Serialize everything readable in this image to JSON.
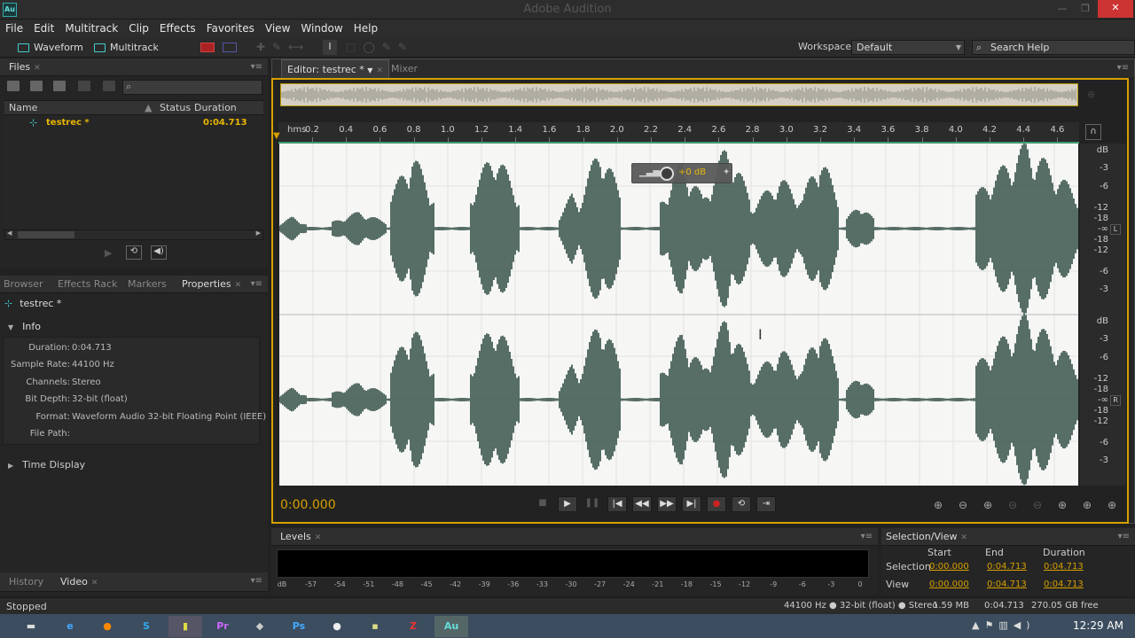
{
  "app": {
    "title": "Adobe Audition",
    "logo": "Au"
  },
  "menu": [
    "File",
    "Edit",
    "Multitrack",
    "Clip",
    "Effects",
    "Favorites",
    "View",
    "Window",
    "Help"
  ],
  "toolbar": {
    "waveform": "Waveform",
    "multitrack": "Multitrack",
    "workspace_label": "Workspace:",
    "workspace_value": "Default",
    "search_placeholder": "Search Help"
  },
  "files": {
    "tab": "Files",
    "columns": {
      "name": "Name",
      "status": "Status",
      "duration": "Duration"
    },
    "items": [
      {
        "name": "testrec *",
        "duration": "0:04.713"
      }
    ]
  },
  "props": {
    "tabs": [
      "Browser",
      "Effects Rack",
      "Markers",
      "Properties"
    ],
    "file": "testrec *",
    "info_header": "Info",
    "rows": [
      {
        "k": "Duration:",
        "v": "0:04.713"
      },
      {
        "k": "Sample Rate:",
        "v": "44100 Hz"
      },
      {
        "k": "Channels:",
        "v": "Stereo"
      },
      {
        "k": "Bit Depth:",
        "v": "32-bit (float)"
      },
      {
        "k": "Format:",
        "v": "Waveform Audio 32-bit Floating Point (IEEE)"
      },
      {
        "k": "File Path:",
        "v": ""
      }
    ],
    "time_display": "Time Display"
  },
  "history": {
    "tabs": [
      "History",
      "Video"
    ]
  },
  "editor": {
    "tab": "Editor: testrec *",
    "mixer": "Mixer",
    "ruler_unit": "hms",
    "ticks": [
      "0.2",
      "0.4",
      "0.6",
      "0.8",
      "1.0",
      "1.2",
      "1.4",
      "1.6",
      "1.8",
      "2.0",
      "2.2",
      "2.4",
      "2.6",
      "2.8",
      "3.0",
      "3.2",
      "3.4",
      "3.6",
      "3.8",
      "4.0",
      "4.2",
      "4.4",
      "4.6"
    ],
    "db_labels": [
      "dB",
      "-3",
      "-6",
      "-12",
      "-18",
      "-∞",
      "-18",
      "-12",
      "-6",
      "-3"
    ],
    "channel_left": "L",
    "channel_right": "R",
    "hud_value": "+0 dB",
    "timecode": "0:00.000"
  },
  "levels": {
    "tab": "Levels",
    "scale": [
      "dB",
      "-57",
      "-54",
      "-51",
      "-48",
      "-45",
      "-42",
      "-39",
      "-36",
      "-33",
      "-30",
      "-27",
      "-24",
      "-21",
      "-18",
      "-15",
      "-12",
      "-9",
      "-6",
      "-3",
      "0"
    ]
  },
  "selection": {
    "tab": "Selection/View",
    "headers": [
      "Start",
      "End",
      "Duration"
    ],
    "selection_label": "Selection",
    "view_label": "View",
    "selection": [
      "0:00.000",
      "0:04.713",
      "0:04.713"
    ],
    "view": [
      "0:00.000",
      "0:04.713",
      "0:04.713"
    ]
  },
  "status": {
    "left": "Stopped",
    "format": "44100 Hz ● 32-bit (float) ● Stereo",
    "size": "1.59 MB",
    "duration": "0:04.713",
    "free": "270.05 GB free"
  },
  "taskbar": {
    "time": "12:29 AM"
  },
  "colors": {
    "accent": "#d7a000",
    "waveform": "#2f4c42",
    "bg": "#252525"
  }
}
